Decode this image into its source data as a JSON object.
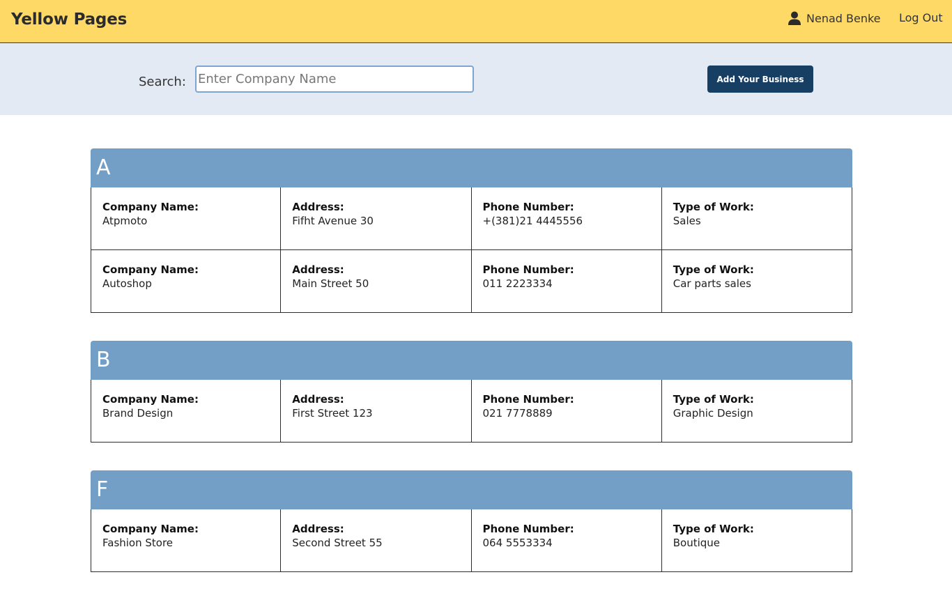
{
  "header": {
    "brand": "Yellow Pages",
    "user_name": "Nenad Benke",
    "logout_label": "Log Out"
  },
  "search": {
    "label": "Search:",
    "placeholder": "Enter Company Name",
    "value": "",
    "add_button": "Add Your Business"
  },
  "labels": {
    "company": "Company Name:",
    "address": "Address:",
    "phone": "Phone Number:",
    "work": "Type of Work:"
  },
  "groups": [
    {
      "letter": "A",
      "entries": [
        {
          "company": "Atpmoto",
          "address": "Fifht Avenue 30",
          "phone": "+(381)21 4445556",
          "work": "Sales"
        },
        {
          "company": "Autoshop",
          "address": "Main Street 50",
          "phone": "011 2223334",
          "work": "Car parts sales"
        }
      ]
    },
    {
      "letter": "B",
      "entries": [
        {
          "company": "Brand Design",
          "address": "First Street 123",
          "phone": "021 7778889",
          "work": "Graphic Design"
        }
      ]
    },
    {
      "letter": "F",
      "entries": [
        {
          "company": "Fashion Store",
          "address": "Second Street 55",
          "phone": "064 5553334",
          "work": "Boutique"
        }
      ]
    }
  ],
  "colors": {
    "navbar": "#ffd966",
    "searchbar": "#e4eaf4",
    "group_header": "#739fc7",
    "button": "#163f63"
  },
  "icons": {
    "user": "user-icon"
  }
}
